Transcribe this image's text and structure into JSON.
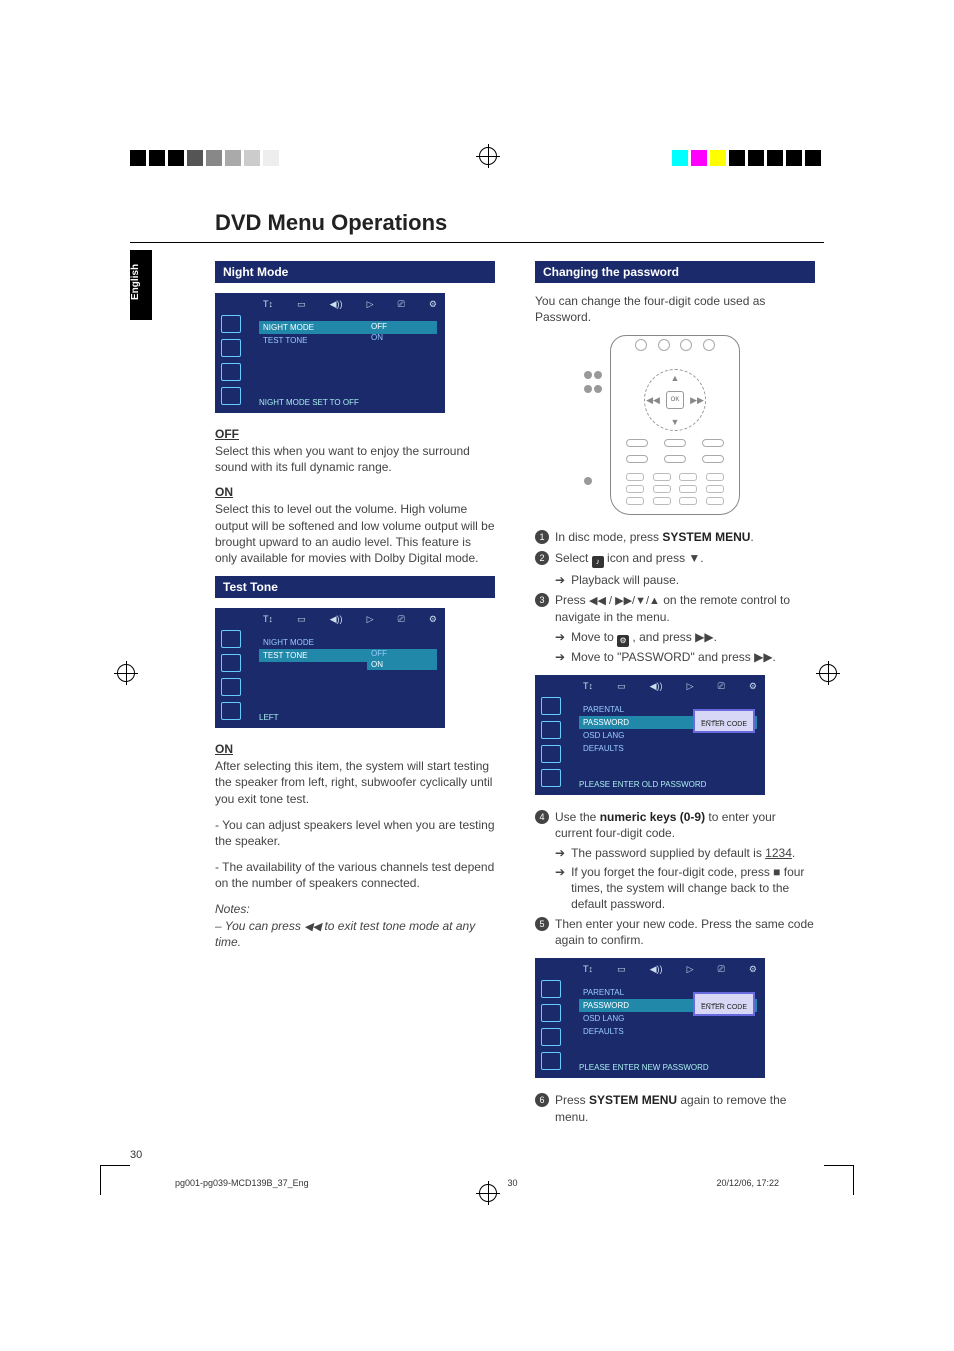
{
  "lang_tab": "English",
  "title": "DVD Menu Operations",
  "page_number": "30",
  "footer_left": "pg001-pg039-MCD139B_37_Eng",
  "footer_mid": "30",
  "footer_right": "20/12/06, 17:22",
  "left": {
    "night_mode": {
      "bar": "Night Mode",
      "osd_items": [
        "NIGHT MODE",
        "TEST TONE"
      ],
      "osd_sel": 0,
      "osd_opts": [
        "OFF",
        "ON"
      ],
      "osd_opt_sel": 0,
      "osd_status": "NIGHT MODE SET TO OFF"
    },
    "off": {
      "head": "OFF",
      "body": "Select this when you want to enjoy the surround sound with its full dynamic range."
    },
    "on": {
      "head": "ON",
      "body": "Select this to level out the volume. High volume output will be softened and low volume output will be brought upward to an audio level. This feature is only available for movies with Dolby Digital mode."
    },
    "test_tone": {
      "bar": "Test Tone",
      "osd_items": [
        "NIGHT MODE",
        "TEST TONE"
      ],
      "osd_sel": 1,
      "osd_opts": [
        "OFF",
        "ON"
      ],
      "osd_opt_sel": 1,
      "osd_status": "LEFT"
    },
    "tt_on": {
      "head": "ON",
      "p1": "After selecting this item, the system will start testing the speaker from left, right, subwoofer cyclically until you exit tone test.",
      "p2": " - You can adjust speakers level when you are testing the speaker.",
      "p3": " - The availability of the various channels test depend on the number of speakers connected."
    },
    "notes": {
      "head": "Notes:",
      "line_pre": "–  You can press ",
      "line_post": "  to exit test tone mode at any time."
    }
  },
  "right": {
    "pw": {
      "bar": "Changing the password",
      "intro": "You can change the four-digit code used as Password."
    },
    "remote_ok": "OK",
    "steps_a": {
      "s1_pre": "In disc mode, press ",
      "s1_b": "SYSTEM MENU",
      "s1_post": ".",
      "s2_pre": "Select ",
      "s2_post": " icon and press ▼.",
      "s2_sub": "Playback will pause.",
      "s3_pre": "Press ",
      "s3_glyphs": "◀◀ / ▶▶/▼/▲",
      "s3_post": "  on the remote control to navigate in the menu.",
      "s3_sub1_pre": "Move to ",
      "s3_sub1_post": " , and press ▶▶.",
      "s3_sub2": "Move to \"PASSWORD\" and press ▶▶."
    },
    "osd_pw_old": {
      "items": [
        "PARENTAL",
        "PASSWORD",
        "OSD LANG",
        "DEFAULTS"
      ],
      "sel": 1,
      "hint": "ENTER CODE",
      "status": "PLEASE ENTER OLD PASSWORD"
    },
    "steps_b": {
      "s4_pre": "Use the ",
      "s4_b": "numeric keys (0-9)",
      "s4_post": " to enter your current four-digit code.",
      "s4_sub1_pre": "The password supplied by default is ",
      "s4_sub1_u": "1234",
      "s4_sub1_post": ".",
      "s4_sub2": "If you forget the four-digit code, press ■ four times, the system will change back to the default password.",
      "s5": "Then enter your new code. Press the same code again to confirm."
    },
    "osd_pw_new": {
      "items": [
        "PARENTAL",
        "PASSWORD",
        "OSD LANG",
        "DEFAULTS"
      ],
      "sel": 1,
      "hint": "ENTER CODE",
      "status": "PLEASE ENTER NEW PASSWORD"
    },
    "steps_c": {
      "s6_pre": "Press ",
      "s6_b": "SYSTEM MENU",
      "s6_post": " again to remove the menu."
    }
  },
  "osd_top_icons": [
    "T↕",
    "▭",
    "◀))",
    "▷",
    "⎚",
    "⚙"
  ]
}
